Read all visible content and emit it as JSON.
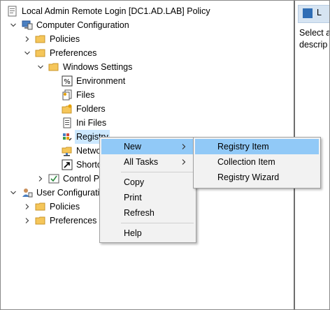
{
  "tree": {
    "root": {
      "label": "Local Admin Remote Login [DC1.AD.LAB] Policy",
      "icon": "policy-document-icon"
    },
    "computer_configuration": {
      "label": "Computer Configuration",
      "icon": "computer-config-icon"
    },
    "cc_policies": {
      "label": "Policies",
      "icon": "folder-icon"
    },
    "cc_preferences": {
      "label": "Preferences",
      "icon": "folder-icon"
    },
    "windows_settings": {
      "label": "Windows Settings",
      "icon": "folder-icon"
    },
    "environment": {
      "label": "Environment",
      "icon": "environment-icon"
    },
    "files": {
      "label": "Files",
      "icon": "files-icon"
    },
    "folders": {
      "label": "Folders",
      "icon": "folders-icon"
    },
    "ini_files": {
      "label": "Ini Files",
      "icon": "ini-files-icon"
    },
    "registry": {
      "label": "Registry",
      "icon": "registry-icon"
    },
    "network_shares": {
      "label": "Netwo",
      "icon": "network-shares-icon"
    },
    "shortcuts": {
      "label": "Shortc",
      "icon": "shortcuts-icon"
    },
    "control_panel": {
      "label": "Control P",
      "icon": "control-panel-icon"
    },
    "user_configuration": {
      "label": "User Configurati",
      "icon": "user-config-icon"
    },
    "uc_policies": {
      "label": "Policies",
      "icon": "folder-icon"
    },
    "uc_preferences": {
      "label": "Preferences",
      "icon": "folder-icon"
    }
  },
  "right_pane": {
    "tab_label": "L",
    "description": "Select a descrip"
  },
  "context_menu": {
    "items": [
      {
        "label": "New",
        "has_submenu": true,
        "highlighted": true
      },
      {
        "label": "All Tasks",
        "has_submenu": true
      },
      {
        "label": "Copy"
      },
      {
        "label": "Print"
      },
      {
        "label": "Refresh"
      },
      {
        "label": "Help"
      }
    ]
  },
  "submenu": {
    "items": [
      {
        "label": "Registry Item",
        "highlighted": true
      },
      {
        "label": "Collection Item"
      },
      {
        "label": "Registry Wizard"
      }
    ]
  },
  "colors": {
    "menu_highlight": "#91c9f7",
    "tree_selection": "#cce8ff",
    "folder": "#f5c65a",
    "menu_background": "#f2f2f2"
  }
}
